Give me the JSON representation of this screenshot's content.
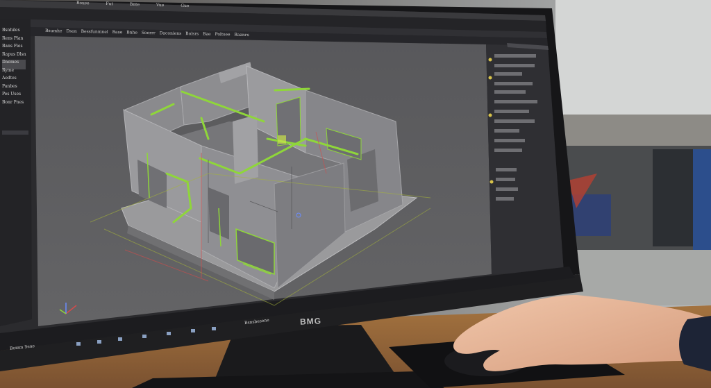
{
  "monitor": {
    "brand": "BMG"
  },
  "app": {
    "menu_items": [
      "Bouse",
      "Fut",
      "Bnte",
      "Vue",
      "Gue"
    ],
    "toolbar_tabs": [
      "Bsumhe Dson",
      "Bessfunmnel",
      "Base",
      "Bnhe",
      "Soerrr",
      "Daconiens",
      "Bolsrs",
      "Bae",
      "Poltsee",
      "Baanrs"
    ],
    "left_panel_items": [
      "Bsnhiles",
      "Rens Plan",
      "Bans Fies",
      "Rapus Dlsn",
      "Daemes",
      "Ryme",
      "Aedtes",
      "Panbes",
      "Pes Uses",
      "Bonr Pnes"
    ],
    "taskbar_text": "Bsnsbesene",
    "taskbar_start": "Bomm Seae"
  },
  "colors": {
    "viewport_bg": "#5c5c5e",
    "ui_dark": "#2a2a2d",
    "wall": "#7f7f82",
    "accent_green": "#8fd63a",
    "desk": "#9b6a3e"
  }
}
